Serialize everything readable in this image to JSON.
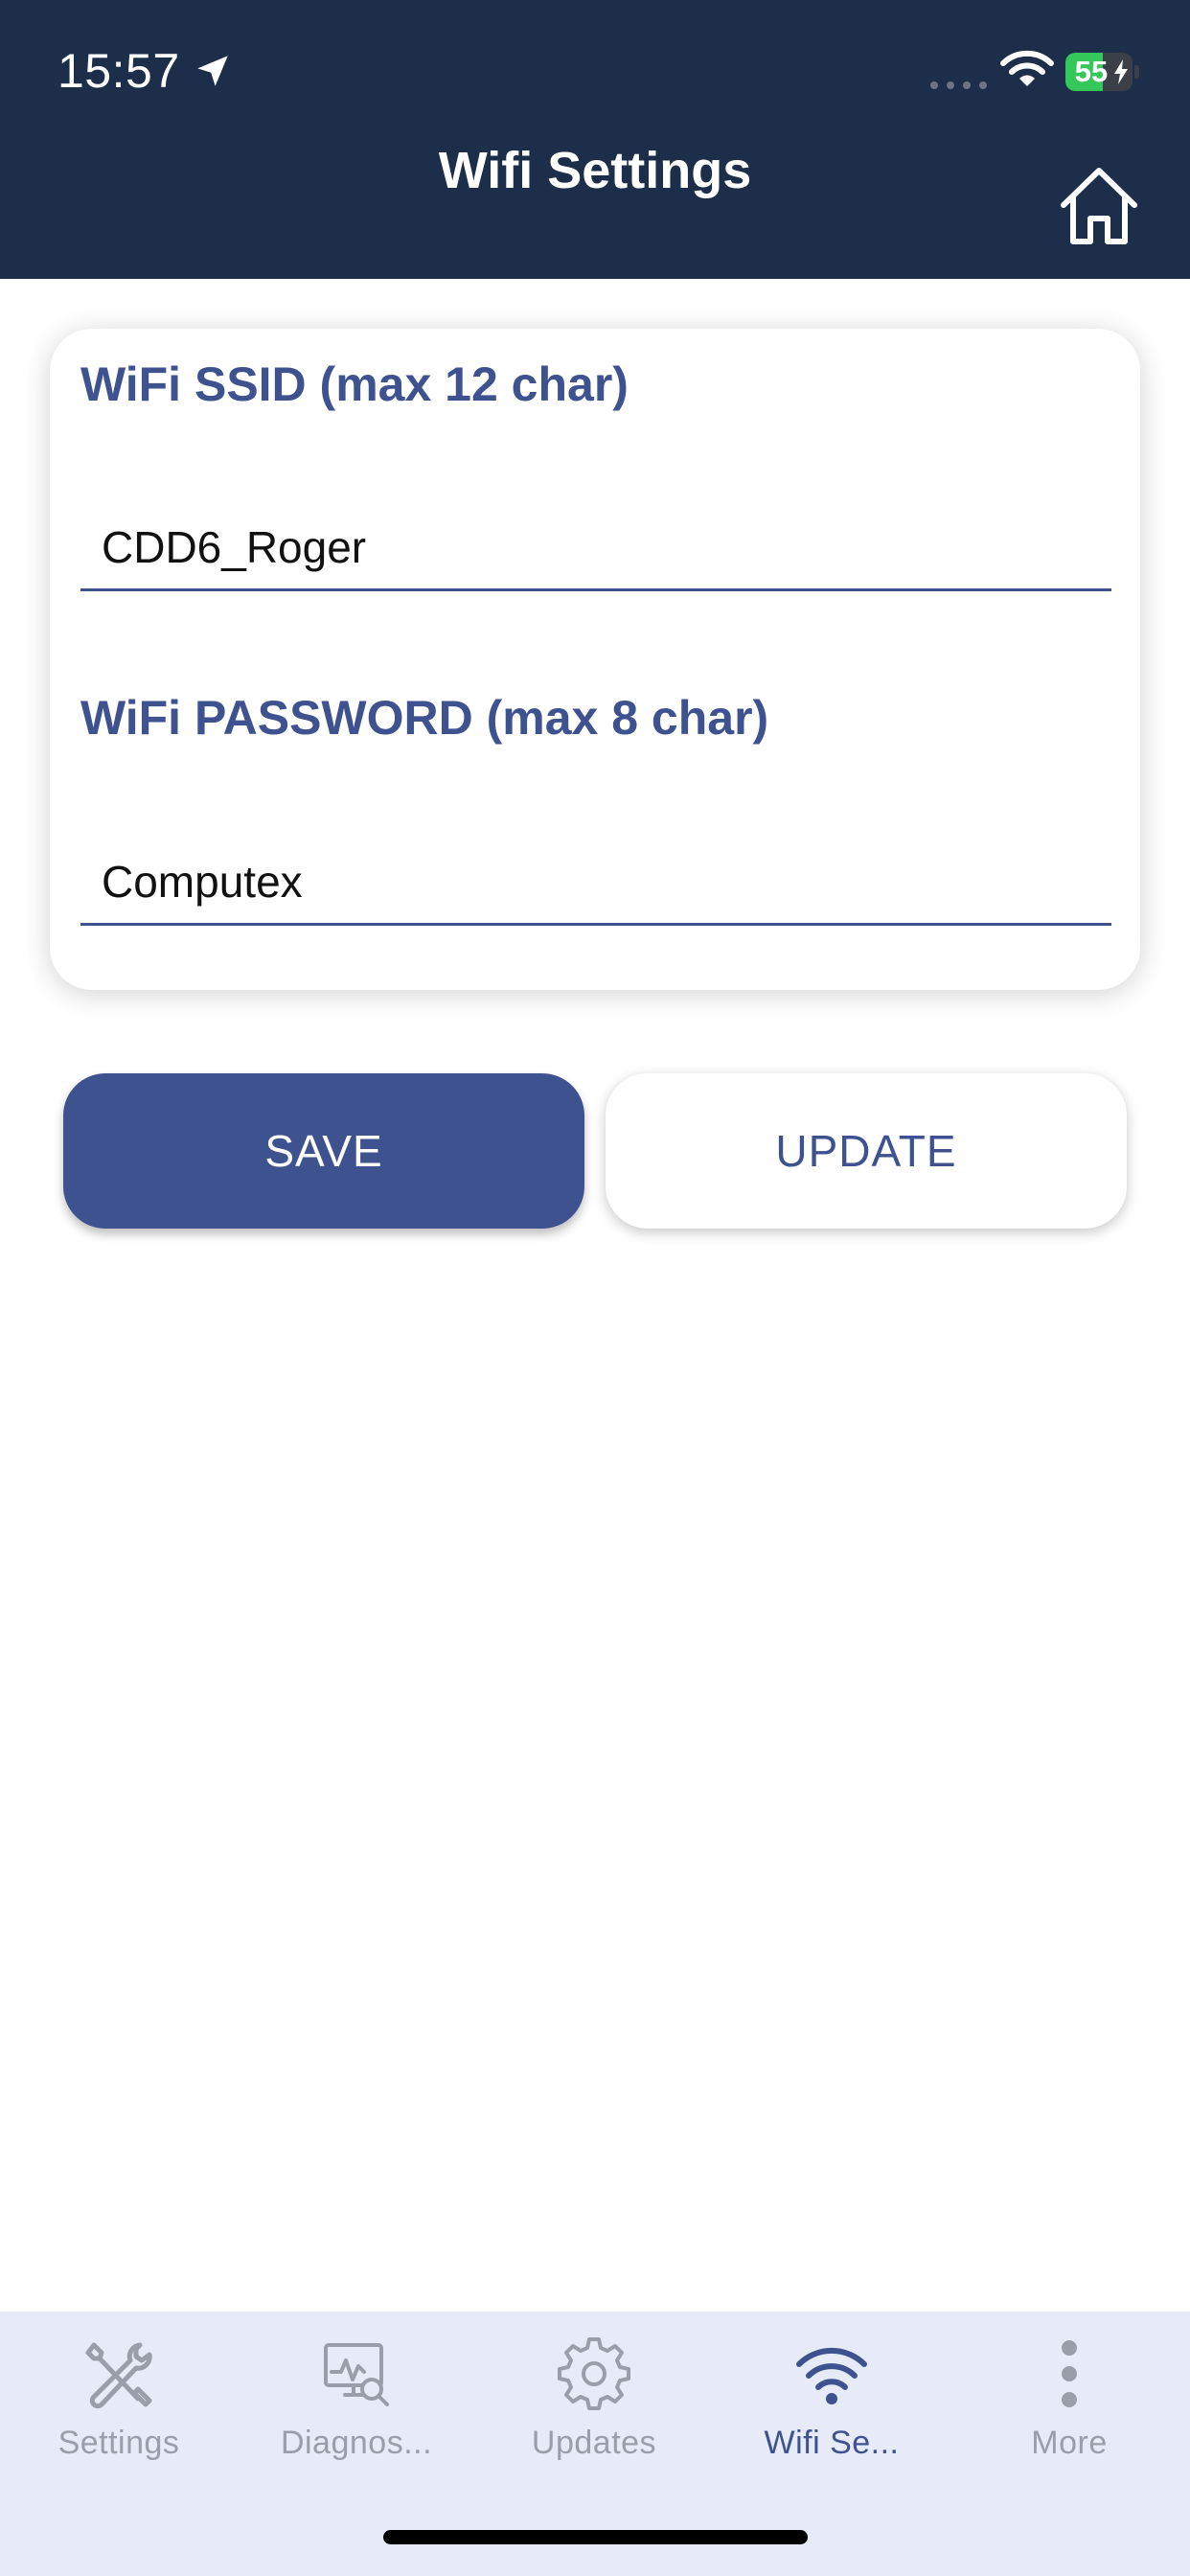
{
  "status_bar": {
    "time": "15:57",
    "battery_level": "55",
    "battery_percent_fill": 55,
    "icons": [
      "location-arrow-icon",
      "cellular-signal-icon",
      "wifi-icon",
      "battery-charging-icon"
    ]
  },
  "header": {
    "title": "Wifi Settings",
    "home_icon": "home-icon"
  },
  "form": {
    "ssid_label": "WiFi SSID (max 12 char)",
    "ssid_value": "CDD6_Roger",
    "password_label": "WiFi PASSWORD (max 8 char)",
    "password_value": "Computex"
  },
  "actions": {
    "save_label": "SAVE",
    "update_label": "UPDATE"
  },
  "tabs": [
    {
      "label": "Settings",
      "icon": "tools-icon",
      "active": false
    },
    {
      "label": "Diagnos...",
      "icon": "diagnostics-icon",
      "active": false
    },
    {
      "label": "Updates",
      "icon": "gear-icon",
      "active": false
    },
    {
      "label": "Wifi Se...",
      "icon": "wifi-icon",
      "active": true
    },
    {
      "label": "More",
      "icon": "more-vertical-icon",
      "active": false
    }
  ],
  "colors": {
    "header_bg": "#1c2e49",
    "accent": "#3f5290",
    "tabbar_bg": "#e6ebf7",
    "inactive_tab": "#9a9ea8",
    "battery_green": "#34c759"
  }
}
